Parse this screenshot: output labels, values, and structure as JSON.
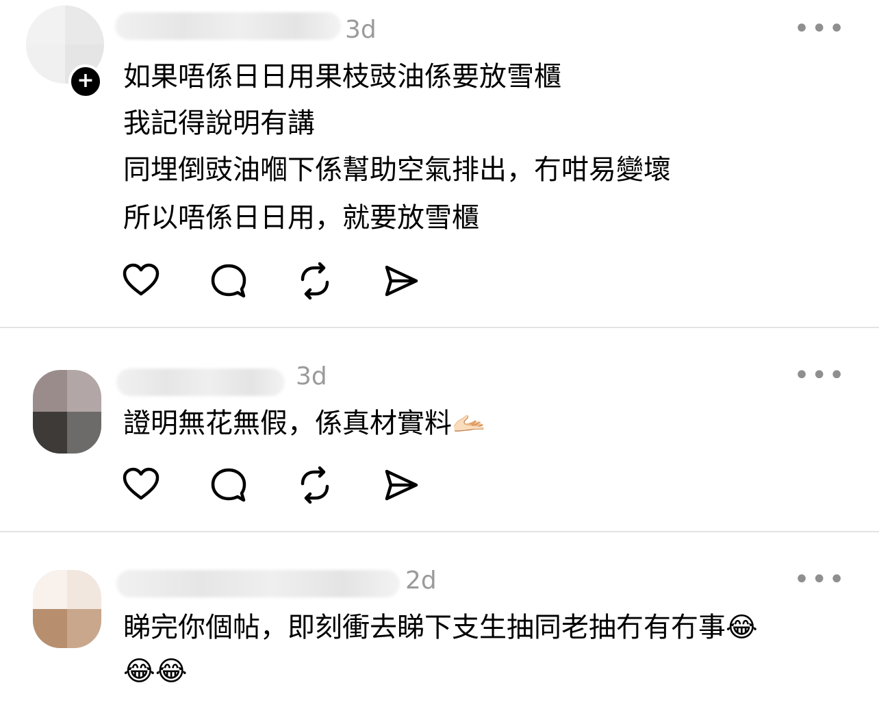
{
  "posts": [
    {
      "time": "3d",
      "lines": [
        "如果唔係日日用果枝豉油係要放雪櫃",
        "我記得說明有講",
        "同埋倒豉油嗰下係幫助空氣排出，冇咁易變壞",
        "所以唔係日日用，就要放雪櫃"
      ],
      "follow_icon": "+"
    },
    {
      "time": "3d",
      "lines": [
        "證明無花無假，係真材實料🫴🏻"
      ]
    },
    {
      "time": "2d",
      "lines": [
        "睇完你個帖，即刻衝去睇下支生抽同老抽冇有冇事😂",
        "😂😂"
      ]
    }
  ],
  "more_label": "•••",
  "icons": [
    "heart-icon",
    "comment-icon",
    "repost-icon",
    "share-icon"
  ],
  "colors": {
    "text": "#000000",
    "muted": "#9a9a9a",
    "divider": "#e3e3e3"
  }
}
